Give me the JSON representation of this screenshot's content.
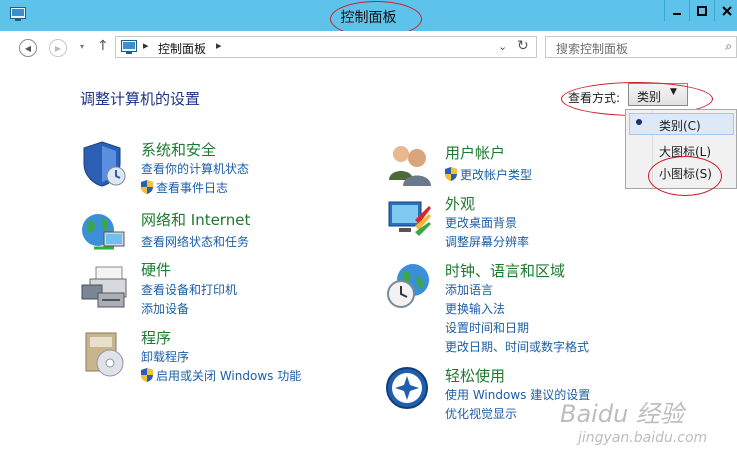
{
  "window": {
    "title": "控制面板"
  },
  "nav": {
    "back": "◀",
    "forward": "▶",
    "up": "↑"
  },
  "address": {
    "crumb": "控制面板"
  },
  "search": {
    "placeholder": "搜索控制面板"
  },
  "main": {
    "heading": "调整计算机的设置"
  },
  "view_by": {
    "label": "查看方式:",
    "selected": "类别",
    "options": [
      "类别(C)",
      "大图标(L)",
      "小图标(S)"
    ]
  },
  "categories": [
    {
      "title": "系统和安全",
      "icon": "system-security-icon",
      "links": [
        {
          "text": "查看你的计算机状态",
          "shield": false
        },
        {
          "text": "查看事件日志",
          "shield": true
        }
      ]
    },
    {
      "title": "网络和 Internet",
      "icon": "network-internet-icon",
      "links": [
        {
          "text": "查看网络状态和任务",
          "shield": false
        }
      ]
    },
    {
      "title": "硬件",
      "icon": "hardware-printer-icon",
      "links": [
        {
          "text": "查看设备和打印机",
          "shield": false
        },
        {
          "text": "添加设备",
          "shield": false
        }
      ]
    },
    {
      "title": "程序",
      "icon": "programs-icon",
      "links": [
        {
          "text": "卸载程序",
          "shield": false
        },
        {
          "text": "启用或关闭 Windows 功能",
          "shield": true
        }
      ]
    },
    {
      "title": "用户帐户",
      "icon": "user-accounts-icon",
      "links": [
        {
          "text": "更改帐户类型",
          "shield": true
        }
      ]
    },
    {
      "title": "外观",
      "icon": "appearance-icon",
      "links": [
        {
          "text": "更改桌面背景",
          "shield": false
        },
        {
          "text": "调整屏幕分辨率",
          "shield": false
        }
      ]
    },
    {
      "title": "时钟、语言和区域",
      "icon": "clock-language-region-icon",
      "links": [
        {
          "text": "添加语言",
          "shield": false
        },
        {
          "text": "更换输入法",
          "shield": false
        },
        {
          "text": "设置时间和日期",
          "shield": false
        },
        {
          "text": "更改日期、时间或数字格式",
          "shield": false
        }
      ]
    },
    {
      "title": "轻松使用",
      "icon": "ease-of-access-icon",
      "links": [
        {
          "text": "使用 Windows 建议的设置",
          "shield": false
        },
        {
          "text": "优化视觉显示",
          "shield": false
        }
      ]
    }
  ],
  "watermark": {
    "main": "Baidu 经验",
    "sub": "jingyan.baidu.com"
  },
  "colors": {
    "titlebar": "#5ec3ea",
    "heading": "#1e3287",
    "category_title": "#1e7a2f",
    "link": "#1c5ea8",
    "annotation": "#d11a2a"
  }
}
